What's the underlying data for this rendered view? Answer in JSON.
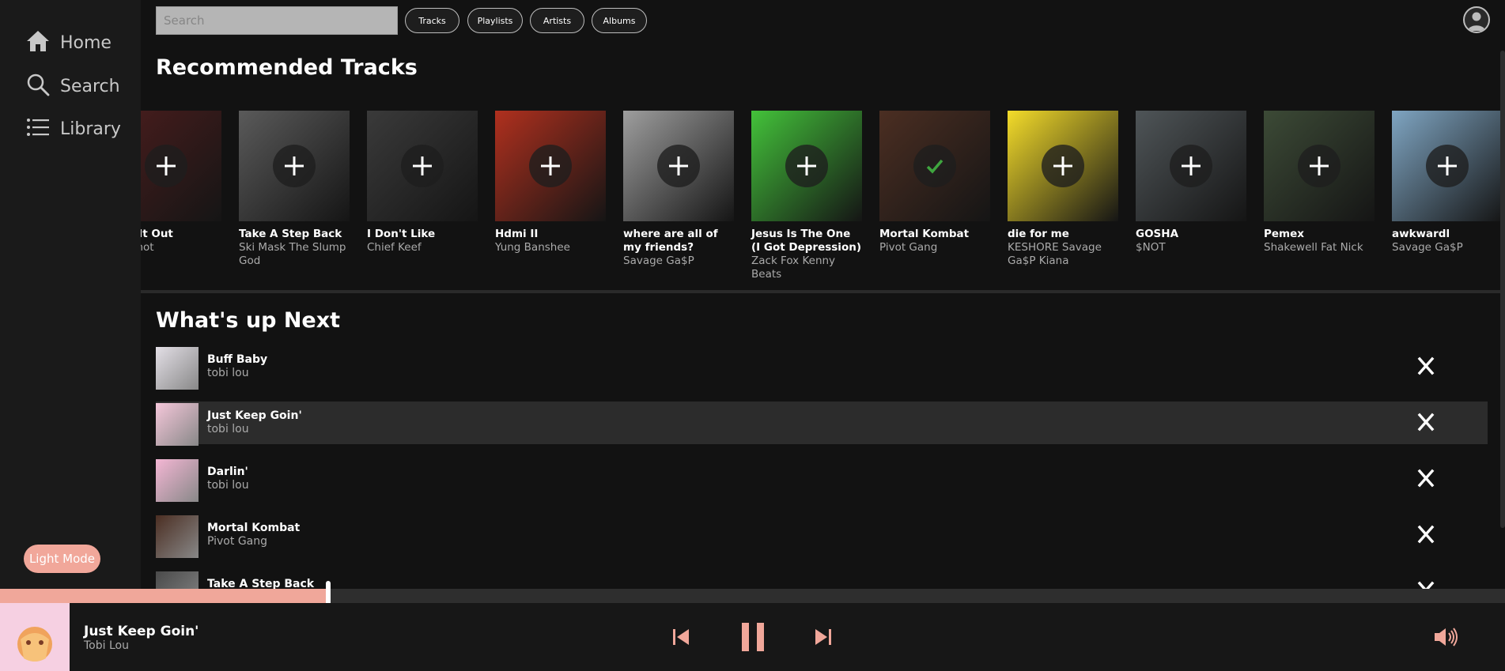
{
  "sidebar": {
    "items": [
      {
        "label": "Home",
        "icon": "home-icon"
      },
      {
        "label": "Search",
        "icon": "search-icon"
      },
      {
        "label": "Library",
        "icon": "library-icon"
      }
    ],
    "theme_toggle": "Light Mode"
  },
  "topbar": {
    "search_placeholder": "Search",
    "filters": [
      "Tracks",
      "Playlists",
      "Artists",
      "Albums"
    ]
  },
  "recommended": {
    "heading": "Recommended Tracks",
    "tracks": [
      {
        "title": "Spit It Out",
        "artist": "Slipknot",
        "added": false,
        "art": "#4a1d1d"
      },
      {
        "title": "Take A Step Back",
        "artist": "Ski Mask The Slump God",
        "added": false,
        "art": "#5a5a5a"
      },
      {
        "title": "I Don't Like",
        "artist": "Chief Keef",
        "added": false,
        "art": "#3a3a3a"
      },
      {
        "title": "Hdmi II",
        "artist": "Yung Banshee",
        "added": false,
        "art": "#b0301e"
      },
      {
        "title": "where are all of my friends?",
        "artist": "Savage Ga$P",
        "added": false,
        "art": "#9e9e9e"
      },
      {
        "title": "Jesus Is The One (I Got Depression)",
        "artist": "Zack Fox Kenny Beats",
        "added": false,
        "art": "#43c23a"
      },
      {
        "title": "Mortal Kombat",
        "artist": "Pivot Gang",
        "added": true,
        "art": "#4b2e22"
      },
      {
        "title": "die for me",
        "artist": "KESHORE Savage Ga$P Kiana",
        "added": false,
        "art": "#f4dc2a"
      },
      {
        "title": "GOSHA",
        "artist": "$NOT",
        "added": false,
        "art": "#4f5558"
      },
      {
        "title": "Pemex",
        "artist": "Shakewell Fat Nick",
        "added": false,
        "art": "#3c4a36"
      },
      {
        "title": "awkwardl",
        "artist": "Savage Ga$P",
        "added": false,
        "art": "#7fa5c2"
      }
    ]
  },
  "queue": {
    "heading": "What's up Next",
    "items": [
      {
        "title": "Buff Baby",
        "artist": "tobi lou",
        "active": false,
        "art": "#e3dfe6"
      },
      {
        "title": "Just Keep Goin'",
        "artist": "tobi lou",
        "active": true,
        "art": "#f5c7da"
      },
      {
        "title": "Darlin'",
        "artist": "tobi lou",
        "active": false,
        "art": "#f4b6d4"
      },
      {
        "title": "Mortal Kombat",
        "artist": "Pivot Gang",
        "active": false,
        "art": "#4b2e22"
      },
      {
        "title": "Take A Step Back",
        "artist": "",
        "active": false,
        "art": "#4a4a4a"
      }
    ],
    "remove_label": "X"
  },
  "player": {
    "title": "Just Keep Goin'",
    "artist": "Tobi Lou",
    "progress": 0.218,
    "state": "playing"
  },
  "colors": {
    "accent": "#f0a79a",
    "background": "#121212",
    "sidebar": "#1a1a1a"
  }
}
